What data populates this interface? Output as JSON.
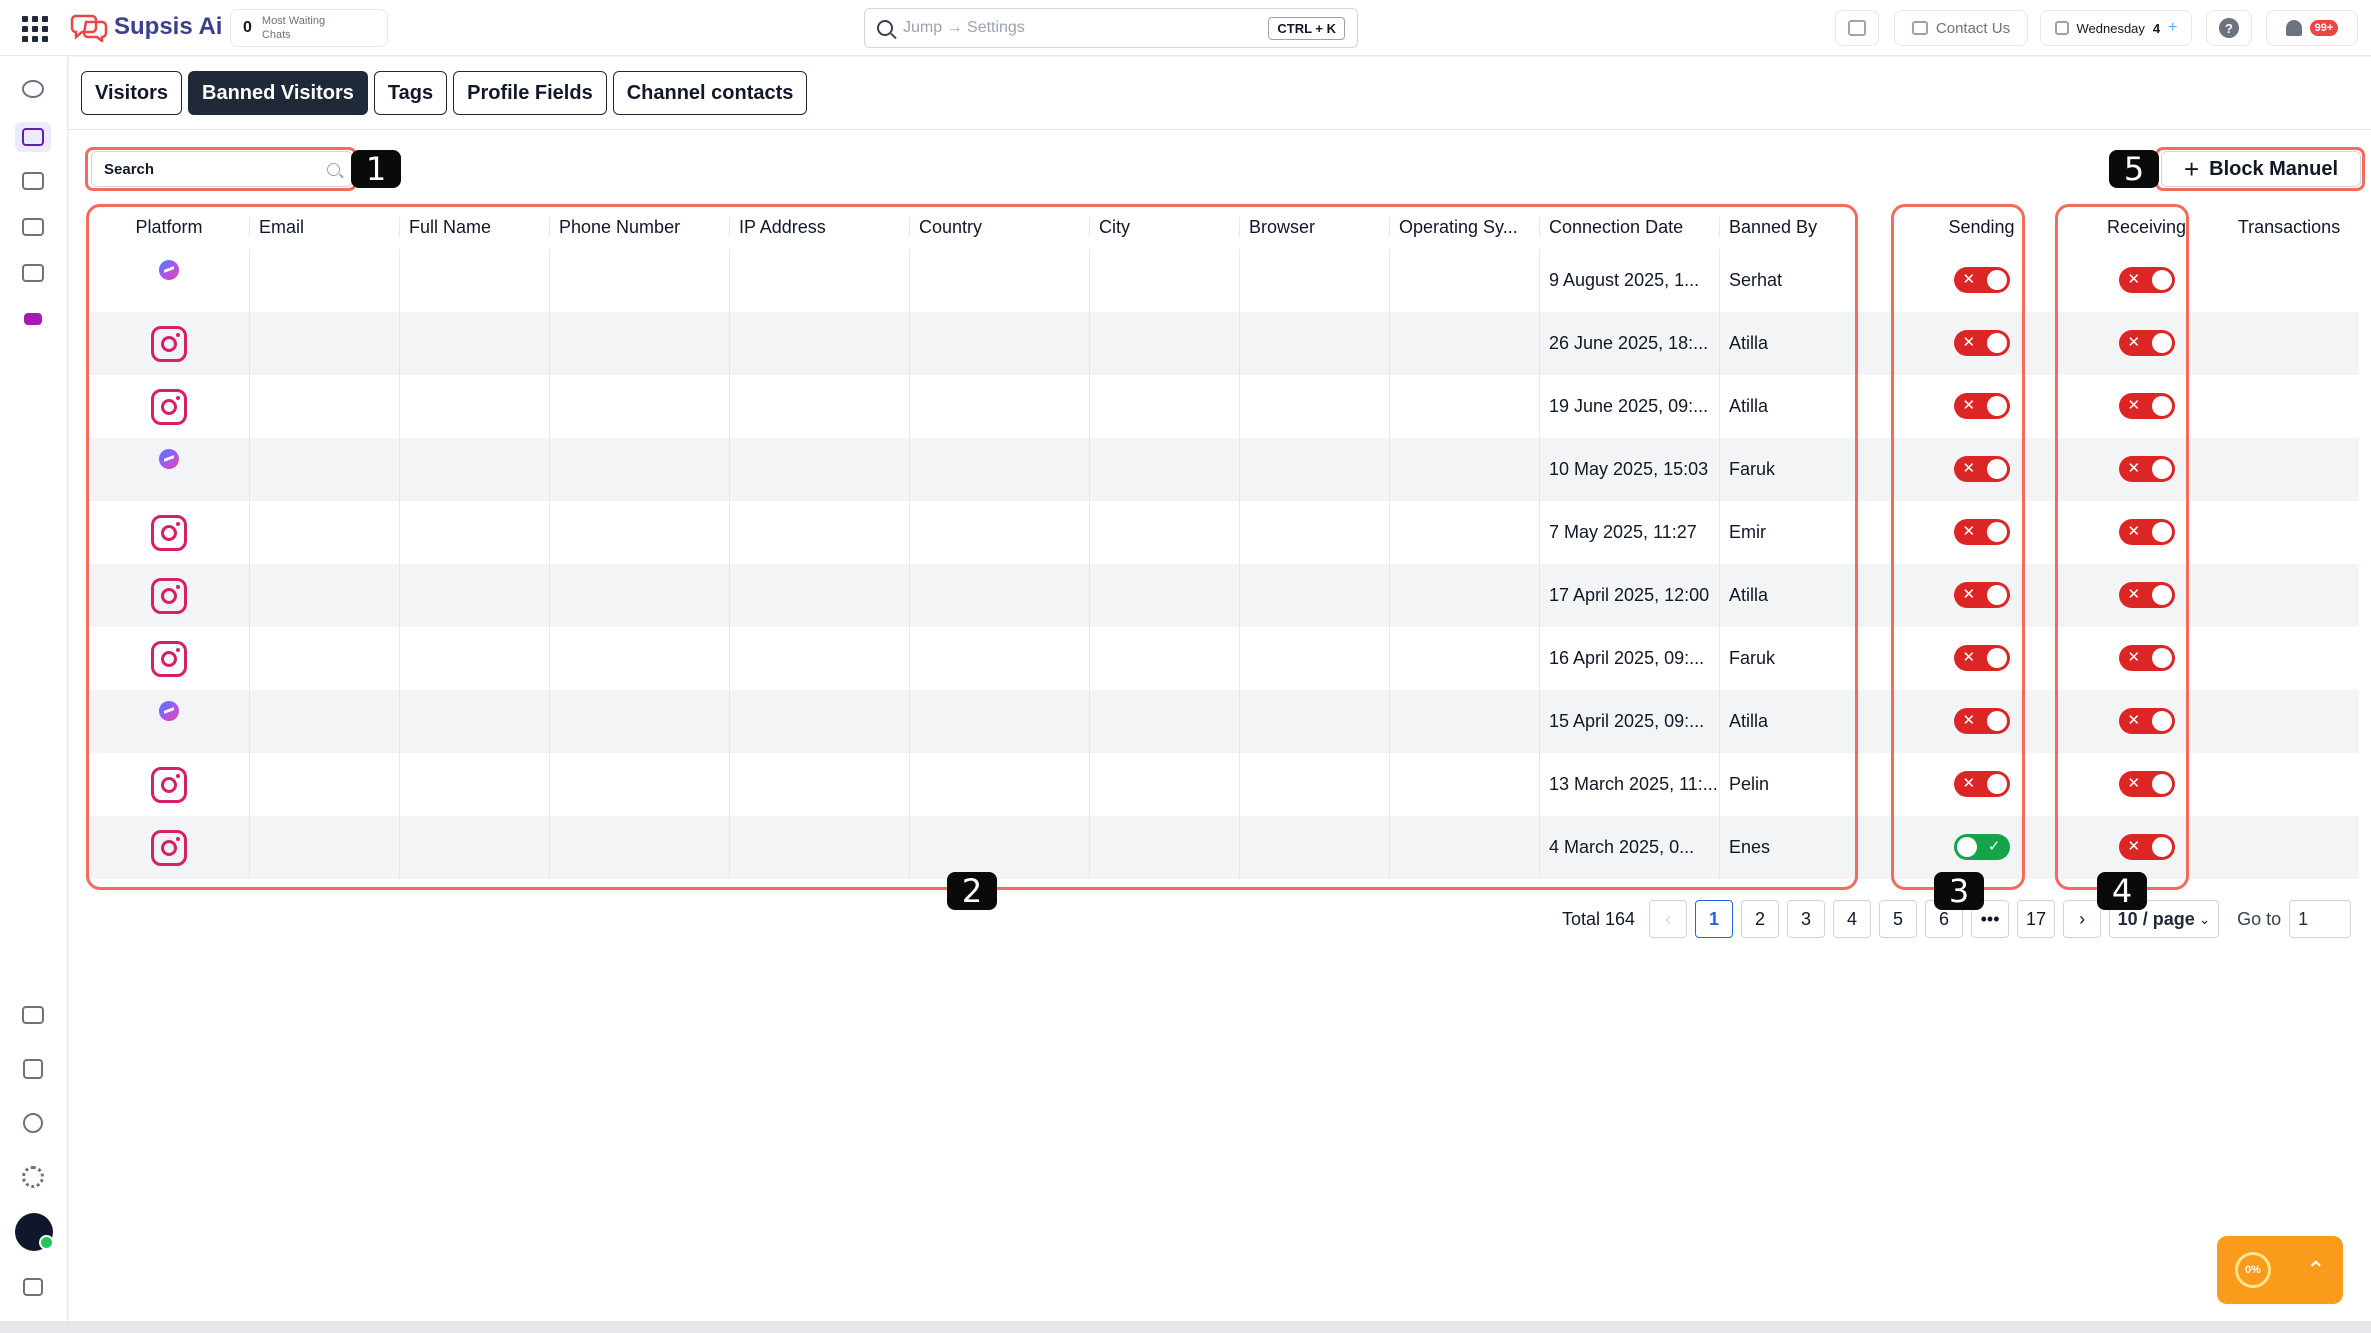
{
  "app": {
    "name": "Supsis Ai"
  },
  "waiting": {
    "count": "0",
    "label": "Most Waiting Chats"
  },
  "jump": {
    "placeholder": "Jump → Settings",
    "shortcut": "CTRL + K"
  },
  "topbar": {
    "contact_us": "Contact Us",
    "day": "Wednesday",
    "day_num": "4",
    "notif_count": "99+"
  },
  "tabs": [
    "Visitors",
    "Banned Visitors",
    "Tags",
    "Profile Fields",
    "Channel contacts"
  ],
  "search": {
    "label": "Search"
  },
  "block_button": {
    "label": "Block Manuel"
  },
  "columns": [
    "Platform",
    "Email",
    "Full Name",
    "Phone Number",
    "IP Address",
    "Country",
    "City",
    "Browser",
    "Operating Sy...",
    "Connection Date",
    "Banned By",
    "Sending",
    "Receiving",
    "Transactions"
  ],
  "rows": [
    {
      "platform": "messenger",
      "date": "9 August 2025, 1...",
      "by": "Serhat",
      "sending": false,
      "receiving": false
    },
    {
      "platform": "instagram",
      "date": "26 June 2025, 18:...",
      "by": "Atilla",
      "sending": false,
      "receiving": false
    },
    {
      "platform": "instagram",
      "date": "19 June 2025, 09:...",
      "by": "Atilla",
      "sending": false,
      "receiving": false
    },
    {
      "platform": "messenger",
      "date": "10 May 2025, 15:03",
      "by": "Faruk",
      "sending": false,
      "receiving": false
    },
    {
      "platform": "instagram",
      "date": "7 May 2025, 11:27",
      "by": "Emir",
      "sending": false,
      "receiving": false
    },
    {
      "platform": "instagram",
      "date": "17 April 2025, 12:00",
      "by": "Atilla",
      "sending": false,
      "receiving": false
    },
    {
      "platform": "instagram",
      "date": "16 April 2025, 09:...",
      "by": "Faruk",
      "sending": false,
      "receiving": false
    },
    {
      "platform": "messenger",
      "date": "15 April 2025, 09:...",
      "by": "Atilla",
      "sending": false,
      "receiving": false
    },
    {
      "platform": "instagram",
      "date": "13 March 2025, 11:...",
      "by": "Pelin",
      "sending": false,
      "receiving": false
    },
    {
      "platform": "instagram",
      "date": "4 March 2025, 0...",
      "by": "Enes",
      "sending": true,
      "receiving": false
    }
  ],
  "pagination": {
    "total": "Total 164",
    "pages": [
      "1",
      "2",
      "3",
      "4",
      "5",
      "6",
      "•••",
      "17"
    ],
    "current": "1",
    "page_size": "10 / page",
    "goto_label": "Go to",
    "goto_value": "1"
  },
  "annotations": [
    "1",
    "2",
    "3",
    "4",
    "5"
  ],
  "progress": {
    "value": "0%"
  },
  "colors": {
    "accent": "#f26b5b",
    "toggle_off": "#dc2626",
    "toggle_on": "#16a34a",
    "instagram": "#d61f69",
    "brand": "#3b3f8f",
    "widget": "#fb9b1c"
  }
}
